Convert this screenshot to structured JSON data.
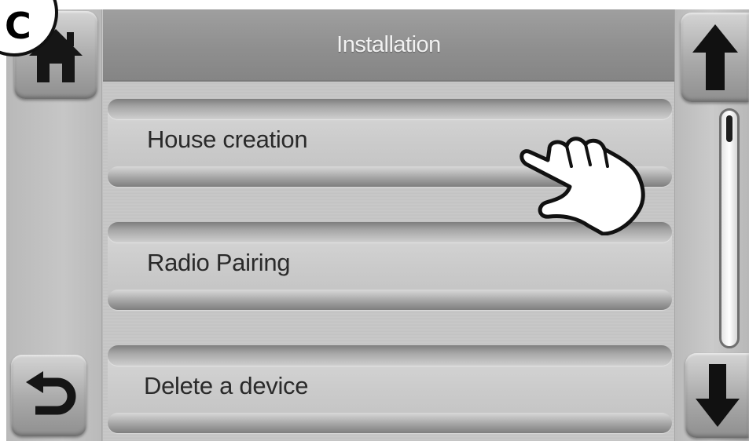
{
  "header": {
    "title": "Installation"
  },
  "menu": {
    "items": [
      {
        "label": "House creation"
      },
      {
        "label": "Radio Pairing"
      },
      {
        "label": "Delete a device"
      }
    ]
  },
  "badge": {
    "letter": "C"
  },
  "icons": {
    "home": "home-icon",
    "back": "back-arrow-icon",
    "up": "arrow-up-icon",
    "down": "arrow-down-icon",
    "pointer": "tap-hand-icon"
  },
  "scrollbar": {
    "position_fraction": 0.0
  }
}
